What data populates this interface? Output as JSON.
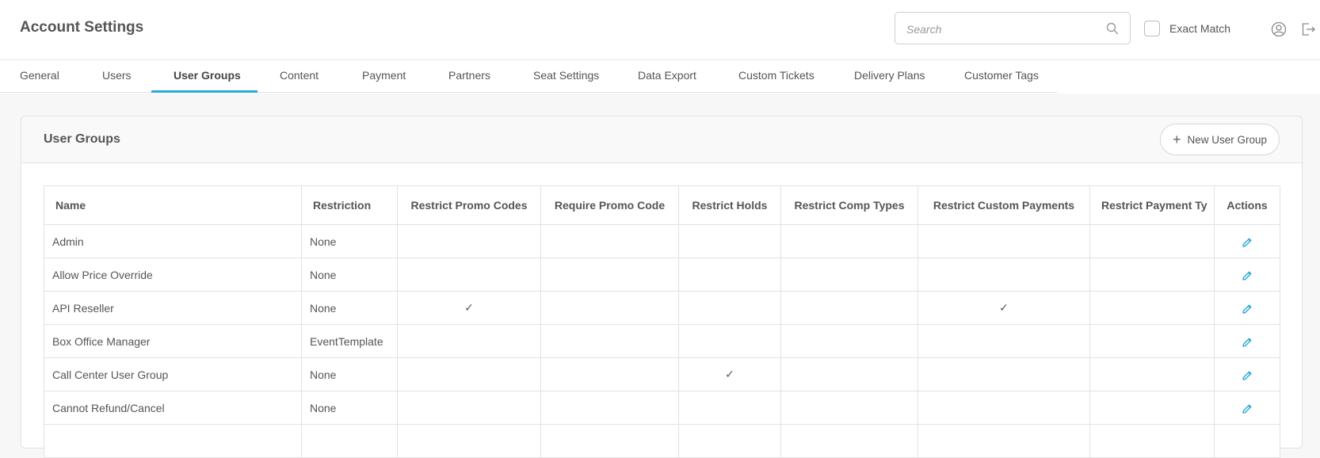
{
  "header": {
    "title": "Account Settings",
    "search_placeholder": "Search",
    "search_value": "",
    "exact_match_label": "Exact Match",
    "exact_match_checked": false
  },
  "tabs": [
    {
      "label": "General"
    },
    {
      "label": "Users"
    },
    {
      "label": "User Groups",
      "active": true
    },
    {
      "label": "Content"
    },
    {
      "label": "Payment"
    },
    {
      "label": "Partners"
    },
    {
      "label": "Seat Settings"
    },
    {
      "label": "Data Export"
    },
    {
      "label": "Custom Tickets"
    },
    {
      "label": "Delivery Plans"
    },
    {
      "label": "Customer Tags"
    }
  ],
  "card": {
    "title": "User Groups",
    "new_button_label": "New User Group"
  },
  "table": {
    "columns": [
      "Name",
      "Restriction",
      "Restrict Promo Codes",
      "Require Promo Code",
      "Restrict Holds",
      "Restrict Comp Types",
      "Restrict Custom Payments",
      "Restrict Payment Ty",
      "Actions"
    ],
    "rows": [
      {
        "name": "Admin",
        "restriction": "None",
        "checks": [
          false,
          false,
          false,
          false,
          false,
          false
        ]
      },
      {
        "name": "Allow Price Override",
        "restriction": "None",
        "checks": [
          false,
          false,
          false,
          false,
          false,
          false
        ]
      },
      {
        "name": "API Reseller",
        "restriction": "None",
        "checks": [
          true,
          false,
          false,
          false,
          true,
          false
        ]
      },
      {
        "name": "Box Office Manager",
        "restriction": "EventTemplate",
        "checks": [
          false,
          false,
          false,
          false,
          false,
          false
        ]
      },
      {
        "name": "Call Center User Group",
        "restriction": "None",
        "checks": [
          false,
          false,
          true,
          false,
          false,
          false
        ]
      },
      {
        "name": "Cannot Refund/Cancel",
        "restriction": "None",
        "checks": [
          false,
          false,
          false,
          false,
          false,
          false
        ]
      },
      {
        "name": "",
        "restriction": "",
        "checks": [
          false,
          false,
          false,
          false,
          false,
          false
        ]
      }
    ]
  },
  "icons": {
    "search": "search-icon",
    "user": "user-circle-icon",
    "logout": "logout-icon",
    "edit": "pencil-icon",
    "check": "checkmark-icon",
    "plus": "plus-icon"
  },
  "colors": {
    "accent": "#2aa8d8",
    "text": "#555555",
    "border": "#e2e2e2"
  }
}
